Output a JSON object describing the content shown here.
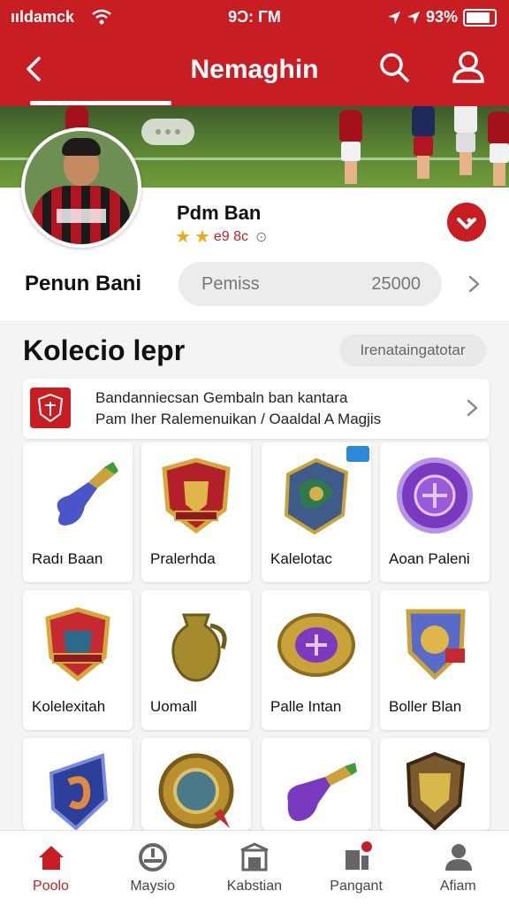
{
  "status_bar": {
    "carrier": "ııldamck",
    "time": "9Ɔ: ΓM",
    "battery": "93%",
    "battery_level": 0.85
  },
  "header": {
    "title": "Nemaghin",
    "back_icon": "chevron-left-icon",
    "search_icon": "search-icon",
    "user_icon": "user-icon"
  },
  "profile": {
    "name": "Pdm Ban",
    "rating_text": "e9 8c",
    "stars": 2,
    "label": "Penun Bani",
    "points_label": "Pemiss",
    "points_value": "25000"
  },
  "collection": {
    "title": "Kolecio lepr",
    "filter": "Irenataingatotar",
    "info_line1": "Bandanniecsan Gembaln ban kantara",
    "info_line2": "Pam Iher Ralemenuikan / Oaaldal A Magjis"
  },
  "items": [
    {
      "label": "Radı Baan",
      "icon": "potion-bottle-icon"
    },
    {
      "label": "Pralerhda",
      "icon": "red-shield-emblem-icon"
    },
    {
      "label": "Kalelotac",
      "icon": "blue-shield-box-icon"
    },
    {
      "label": "Aoan Paleni",
      "icon": "purple-badge-icon"
    },
    {
      "label": "Kolelexitah",
      "icon": "crest-shield-icon"
    },
    {
      "label": "Uomall",
      "icon": "golden-vase-icon"
    },
    {
      "label": "Palle Intan",
      "icon": "gold-coin-icon"
    },
    {
      "label": "Boller Blan",
      "icon": "lion-shield-icon"
    },
    {
      "label": "",
      "icon": "blue-shield-icon"
    },
    {
      "label": "",
      "icon": "gold-medallion-icon"
    },
    {
      "label": "",
      "icon": "purple-potion-icon"
    },
    {
      "label": "",
      "icon": "gold-shield-icon"
    }
  ],
  "bottom_nav": [
    {
      "label": "Poolo",
      "icon": "home-icon",
      "active": true
    },
    {
      "label": "Maysio",
      "icon": "gauge-icon",
      "active": false
    },
    {
      "label": "Kabstian",
      "icon": "store-icon",
      "active": false
    },
    {
      "label": "Pangant",
      "icon": "bag-icon",
      "active": false
    },
    {
      "label": "Afiam",
      "icon": "person-icon",
      "active": false
    }
  ],
  "colors": {
    "brand_red": "#c81e23",
    "star_gold": "#f0a81a"
  }
}
